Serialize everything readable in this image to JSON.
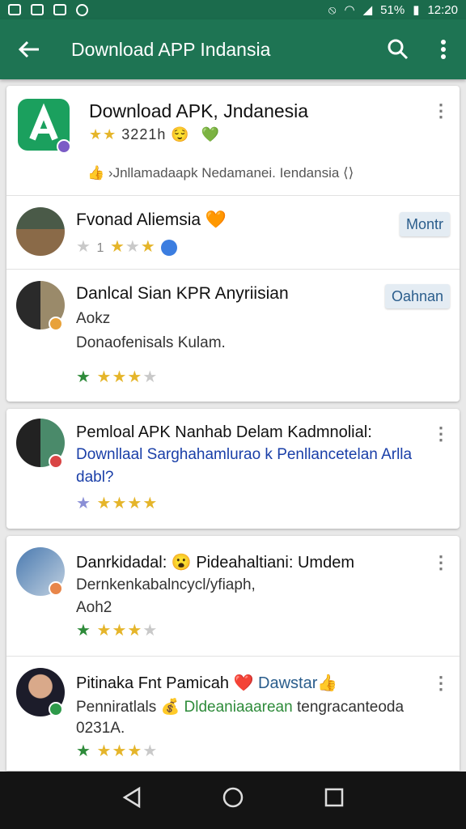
{
  "status_bar": {
    "signal": "%",
    "battery": "51%",
    "time": "12:20"
  },
  "app_bar": {
    "title": "Download APP Indansia"
  },
  "featured": {
    "title": "Download APK, Jndanesia",
    "rating_text": "3221h",
    "emoji": "😌",
    "heart": "💚",
    "footer_text": "›Jnllamadaapk Nedamanei. Iendansia"
  },
  "items": [
    {
      "title": "Fvonad Aliemsia",
      "emoji": "🧡",
      "rating_text": "1",
      "button_label": "Montr"
    },
    {
      "title": "Danlcal Sian KPR Anyriisian",
      "subtitle_1": "Aokz",
      "subtitle_2": "Donaofenisals Kulam.",
      "button_label": "Oahnan"
    }
  ],
  "card2": {
    "title": "Pemloal APK Nanhab Delam Kadmnolial:",
    "desc_1": "Downllaal Sarghahamlurao k Penllancetelan Arlla",
    "desc_2": "dabl?"
  },
  "card3": [
    {
      "title": "Danrkidadal:",
      "emoji": "😮",
      "title_2": "Pideahaltiani: Umdem",
      "sub_1": "Dernkenkabalncycl/yfiaph,",
      "sub_2": "Aoh2"
    },
    {
      "title": "Pitinaka Fnt Pamicah",
      "emoji": "❤️",
      "extra": "Dawstar",
      "extra_emoji": "👍",
      "sub_1": "Penniratlals",
      "sub_icon": "💰",
      "sub_green": "Dldeaniaaarean",
      "sub_1b": "tengracanteoda",
      "sub_2": "0231A."
    }
  ],
  "stars_glyph": "★",
  "colors": {
    "app_bar": "#1e7453",
    "status_bar": "#1b6b4c",
    "star": "#e5b52a",
    "link": "#1a3fa8"
  }
}
